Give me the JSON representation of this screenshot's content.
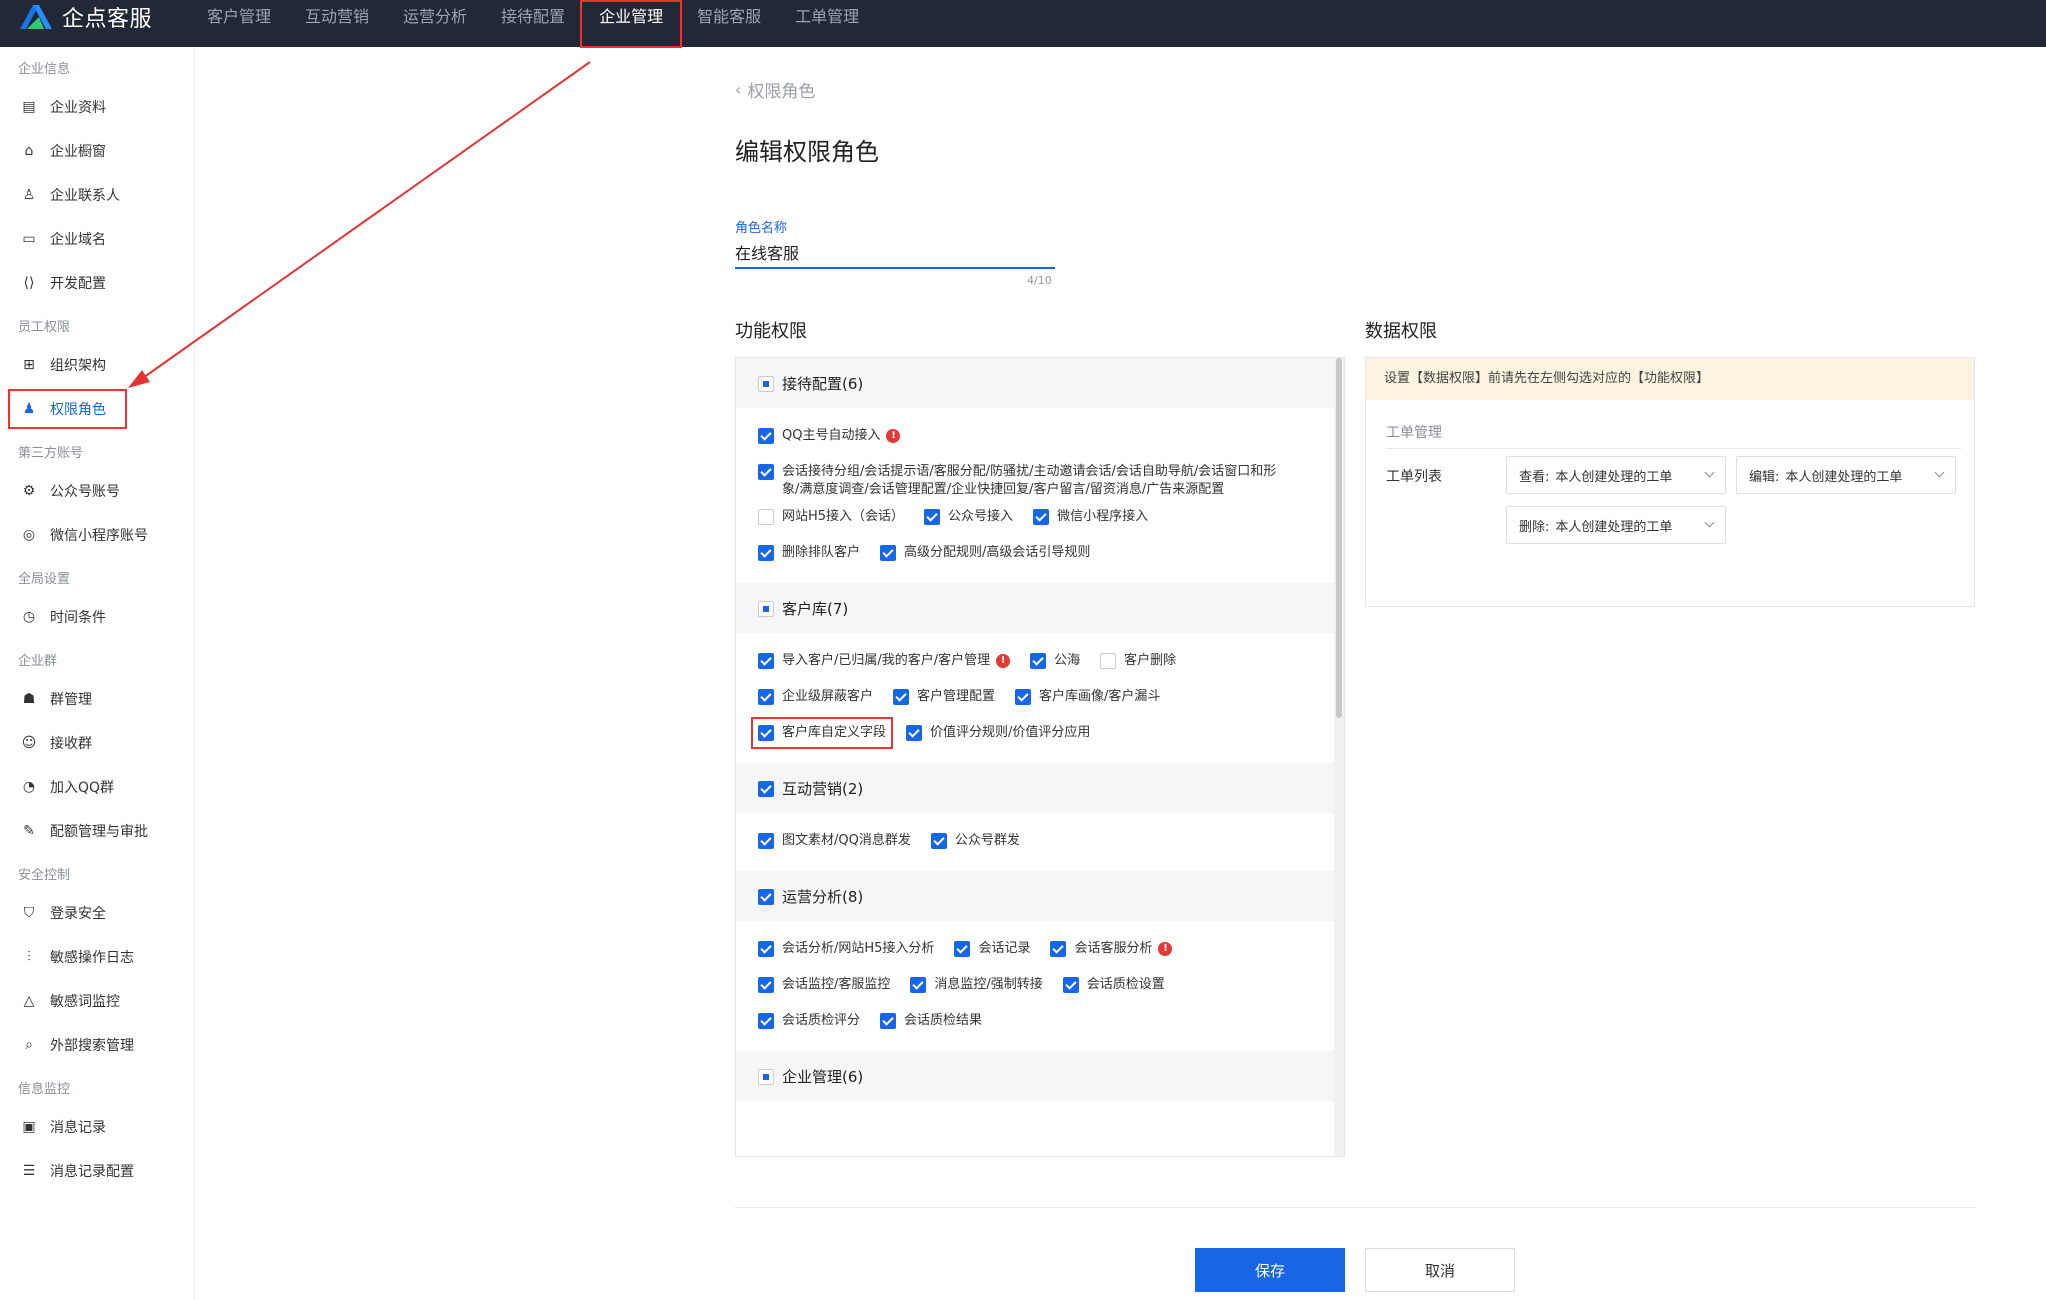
{
  "app": {
    "logo_text": "企点客服",
    "nav": [
      {
        "label": "客户管理",
        "active": false
      },
      {
        "label": "互动营销",
        "active": false
      },
      {
        "label": "运营分析",
        "active": false
      },
      {
        "label": "接待配置",
        "active": false
      },
      {
        "label": "企业管理",
        "active": true
      },
      {
        "label": "智能客服",
        "active": false
      },
      {
        "label": "工单管理",
        "active": false
      }
    ]
  },
  "sidebar": {
    "groups": [
      {
        "title": "企业信息",
        "items": [
          {
            "label": "企业资料",
            "icon": "document-icon"
          },
          {
            "label": "企业橱窗",
            "icon": "store-icon"
          },
          {
            "label": "企业联系人",
            "icon": "contact-icon"
          },
          {
            "label": "企业域名",
            "icon": "domain-icon"
          },
          {
            "label": "开发配置",
            "icon": "code-icon"
          }
        ]
      },
      {
        "title": "员工权限",
        "items": [
          {
            "label": "组织架构",
            "icon": "org-chart-icon"
          },
          {
            "label": "权限角色",
            "icon": "role-icon",
            "active": true
          }
        ]
      },
      {
        "title": "第三方账号",
        "items": [
          {
            "label": "公众号账号",
            "icon": "official-account-icon"
          },
          {
            "label": "微信小程序账号",
            "icon": "mini-program-icon"
          }
        ]
      },
      {
        "title": "全局设置",
        "items": [
          {
            "label": "时间条件",
            "icon": "calendar-clock-icon"
          }
        ]
      },
      {
        "title": "企业群",
        "items": [
          {
            "label": "群管理",
            "icon": "group-icon"
          },
          {
            "label": "接收群",
            "icon": "receive-group-icon"
          },
          {
            "label": "加入QQ群",
            "icon": "qq-group-icon"
          },
          {
            "label": "配额管理与审批",
            "icon": "quota-icon"
          }
        ]
      },
      {
        "title": "安全控制",
        "items": [
          {
            "label": "登录安全",
            "icon": "shield-icon"
          },
          {
            "label": "敏感操作日志",
            "icon": "sliders-icon"
          },
          {
            "label": "敏感词监控",
            "icon": "warning-triangle-icon"
          },
          {
            "label": "外部搜索管理",
            "icon": "search-window-icon"
          }
        ]
      },
      {
        "title": "信息监控",
        "items": [
          {
            "label": "消息记录",
            "icon": "message-record-icon"
          },
          {
            "label": "消息记录配置",
            "icon": "message-config-icon"
          }
        ]
      }
    ]
  },
  "page": {
    "breadcrumb": "权限角色",
    "title": "编辑权限角色",
    "role_name_label": "角色名称",
    "role_name_value": "在线客服",
    "role_name_count": "4/10",
    "func_title": "功能权限",
    "data_title": "数据权限"
  },
  "func_groups": [
    {
      "title": "接待配置(6)",
      "state": "partial",
      "rows": [
        [
          {
            "label": "QQ主号自动接入",
            "checked": true,
            "warn": true
          }
        ],
        [
          {
            "label": "会话接待分组/会话提示语/客服分配/防骚扰/主动邀请会话/会话自助导航/会话窗口和形象/满意度调查/会话管理配置/企业快捷回复/客户留言/留资消息/广告来源配置",
            "checked": true,
            "long": true
          }
        ],
        [
          {
            "label": "网站H5接入（会话）",
            "checked": false
          },
          {
            "label": "公众号接入",
            "checked": true
          },
          {
            "label": "微信小程序接入",
            "checked": true
          }
        ],
        [
          {
            "label": "删除排队客户",
            "checked": true
          },
          {
            "label": "高级分配规则/高级会话引导规则",
            "checked": true
          }
        ]
      ]
    },
    {
      "title": "客户库(7)",
      "state": "partial",
      "rows": [
        [
          {
            "label": "导入客户/已归属/我的客户/客户管理",
            "checked": true,
            "warn": true
          },
          {
            "label": "公海",
            "checked": true
          },
          {
            "label": "客户删除",
            "checked": false
          }
        ],
        [
          {
            "label": "企业级屏蔽客户",
            "checked": true
          },
          {
            "label": "客户管理配置",
            "checked": true
          },
          {
            "label": "客户库画像/客户漏斗",
            "checked": true
          }
        ],
        [
          {
            "label": "客户库自定义字段",
            "checked": true,
            "highlight": true
          },
          {
            "label": "价值评分规则/价值评分应用",
            "checked": true
          }
        ]
      ]
    },
    {
      "title": "互动营销(2)",
      "state": "checked",
      "rows": [
        [
          {
            "label": "图文素材/QQ消息群发",
            "checked": true
          },
          {
            "label": "公众号群发",
            "checked": true
          }
        ]
      ]
    },
    {
      "title": "运营分析(8)",
      "state": "checked",
      "rows": [
        [
          {
            "label": "会话分析/网站H5接入分析",
            "checked": true
          },
          {
            "label": "会话记录",
            "checked": true
          },
          {
            "label": "会话客服分析",
            "checked": true,
            "warn": true
          }
        ],
        [
          {
            "label": "会话监控/客服监控",
            "checked": true
          },
          {
            "label": "消息监控/强制转接",
            "checked": true
          },
          {
            "label": "会话质检设置",
            "checked": true
          }
        ],
        [
          {
            "label": "会话质检评分",
            "checked": true
          },
          {
            "label": "会话质检结果",
            "checked": true
          }
        ]
      ]
    },
    {
      "title": "企业管理(6)",
      "state": "partial",
      "rows": []
    }
  ],
  "data_perm": {
    "notice": "设置【数据权限】前请先在左侧勾选对应的【功能权限】",
    "subtitle": "工单管理",
    "row_label": "工单列表",
    "view_key": "查看:",
    "view_value": "本人创建处理的工单",
    "edit_key": "编辑:",
    "edit_value": "本人创建处理的工单",
    "delete_key": "删除:",
    "delete_value": "本人创建处理的工单"
  },
  "footer": {
    "save_label": "保存",
    "cancel_label": "取消"
  },
  "colors": {
    "topbar": "#212936",
    "accent": "#1766e5",
    "annotation": "#e33333",
    "notice_bg": "#fdf3e1"
  }
}
